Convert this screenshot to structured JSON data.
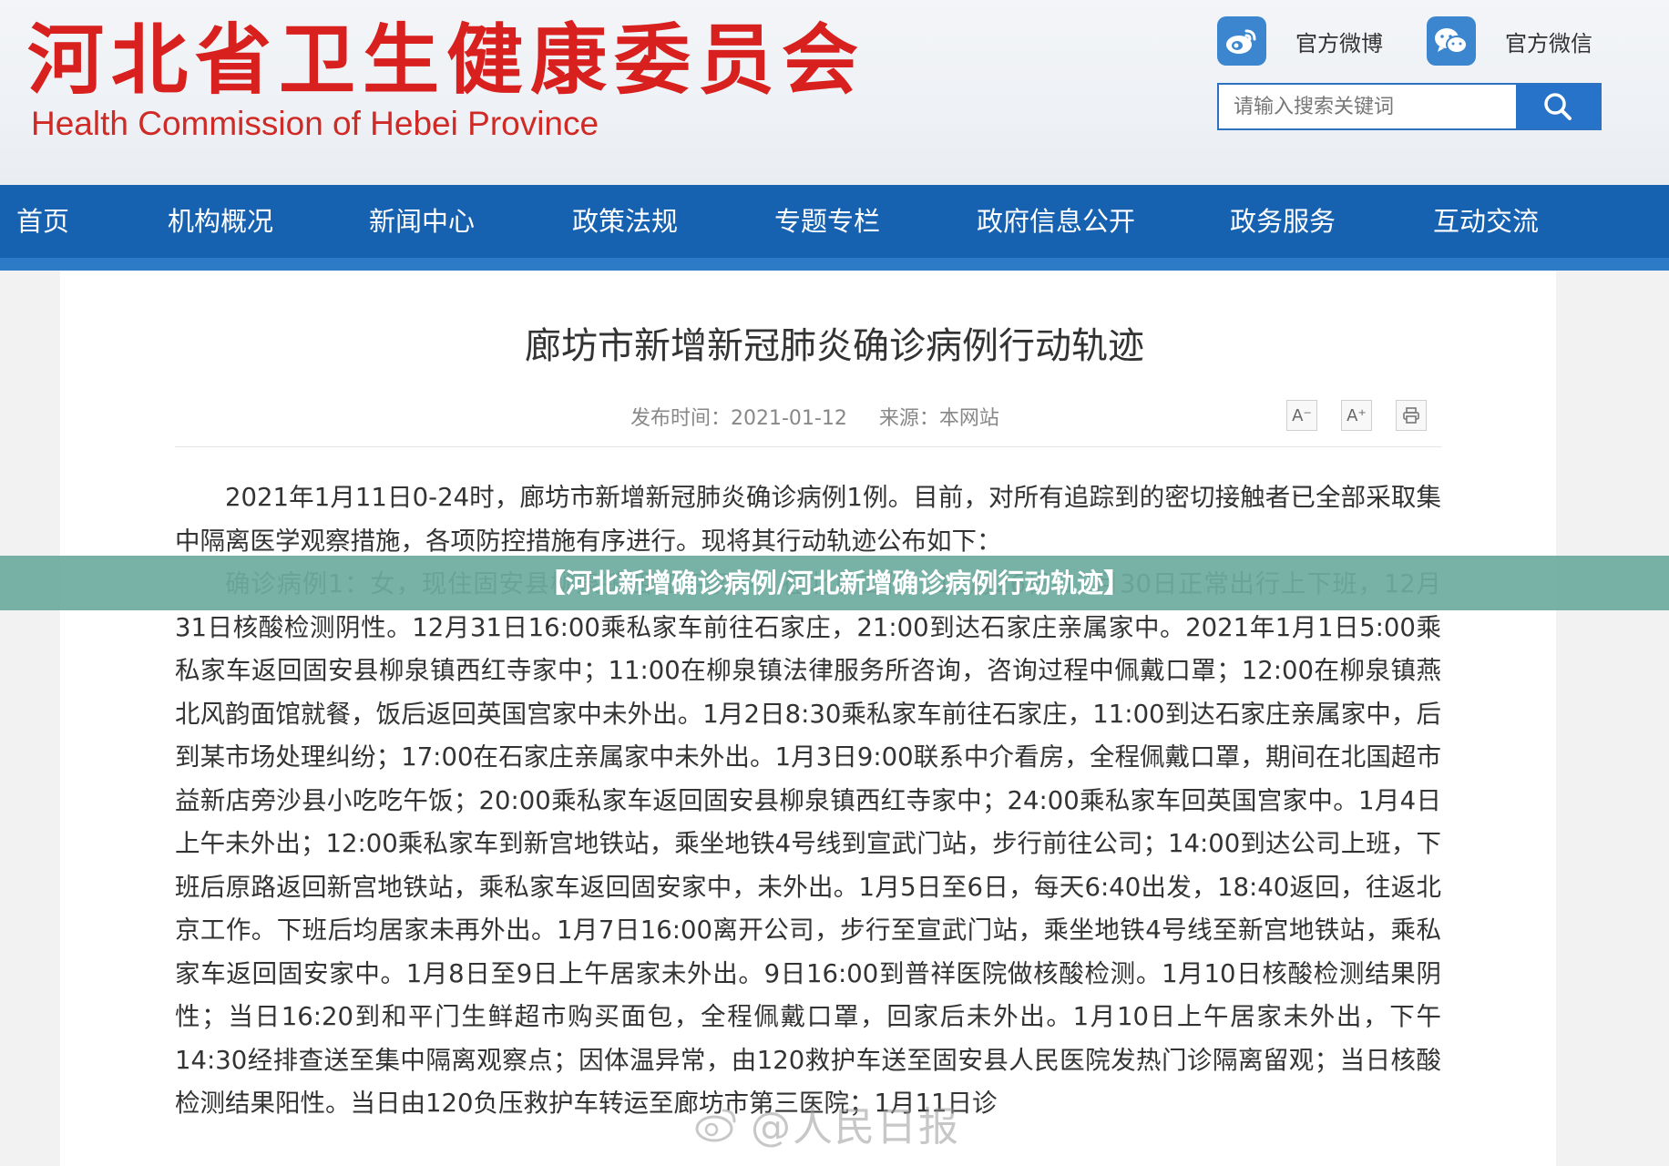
{
  "header": {
    "logo_cn": "河北省卫生健康委员会",
    "logo_en": "Health Commission of Hebei Province",
    "weibo_label": "官方微博",
    "wechat_label": "官方微信",
    "search_placeholder": "请输入搜索关键词"
  },
  "nav": {
    "items": [
      "首页",
      "机构概况",
      "新闻中心",
      "政策法规",
      "专题专栏",
      "政府信息公开",
      "政务服务",
      "互动交流"
    ]
  },
  "article": {
    "title": "廊坊市新增新冠肺炎确诊病例行动轨迹",
    "publish_time": "发布时间：2021-01-12",
    "source": "来源：本网站",
    "font_decrease": "A⁻",
    "font_increase": "A⁺",
    "paragraph1": "2021年1月11日0-24时，廊坊市新增新冠肺炎确诊病例1例。目前，对所有追踪到的密切接触者已全部采取集中隔离医学观察措施，各项防控措施有序进行。现将其行动轨迹公布如下：",
    "paragraph2": "确诊病例1：女，现住固安县柳泉镇西红寺家中，在北京工作，12月26日-12月30日正常出行上下班，12月31日核酸检测阴性。12月31日16:00乘私家车前往石家庄，21:00到达石家庄亲属家中。2021年1月1日5:00乘私家车返回固安县柳泉镇西红寺家中；11:00在柳泉镇法律服务所咨询，咨询过程中佩戴口罩；12:00在柳泉镇燕北风韵面馆就餐，饭后返回英国宫家中未外出。1月2日8:30乘私家车前往石家庄，11:00到达石家庄亲属家中，后到某市场处理纠纷；17:00在石家庄亲属家中未外出。1月3日9:00联系中介看房，全程佩戴口罩，期间在北国超市益新店旁沙县小吃吃午饭；20:00乘私家车返回固安县柳泉镇西红寺家中；24:00乘私家车回英国宫家中。1月4日上午未外出；12:00乘私家车到新宫地铁站，乘坐地铁4号线到宣武门站，步行前往公司；14:00到达公司上班，下班后原路返回新宫地铁站，乘私家车返回固安家中，未外出。1月5日至6日，每天6:40出发，18:40返回，往返北京工作。下班后均居家未再外出。1月7日16:00离开公司，步行至宣武门站，乘坐地铁4号线至新宫地铁站，乘私家车返回固安家中。1月8日至9日上午居家未外出。9日16:00到普祥医院做核酸检测。1月10日核酸检测结果阴性；当日16:20到和平门生鲜超市购买面包，全程佩戴口罩，回家后未外出。1月10日上午居家未外出，下午14:30经排查送至集中隔离观察点；因体温异常，由120救护车送至固安县人民医院发热门诊隔离留观；当日核酸检测结果阳性。当日由120负压救护车转运至廊坊市第三医院；1月11日诊"
  },
  "banner": {
    "text": "【河北新增确诊病例/河北新增确诊病例行动轨迹】"
  },
  "watermark": {
    "text": "@人民日报"
  },
  "colors": {
    "brand_red": "#d8201f",
    "nav_blue": "#1662b1",
    "accent_blue": "#2673c9",
    "banner_green": "#6eaca0"
  },
  "icons": {
    "weibo": "weibo-icon",
    "wechat": "wechat-icon",
    "search": "search-icon",
    "print": "printer-icon"
  }
}
